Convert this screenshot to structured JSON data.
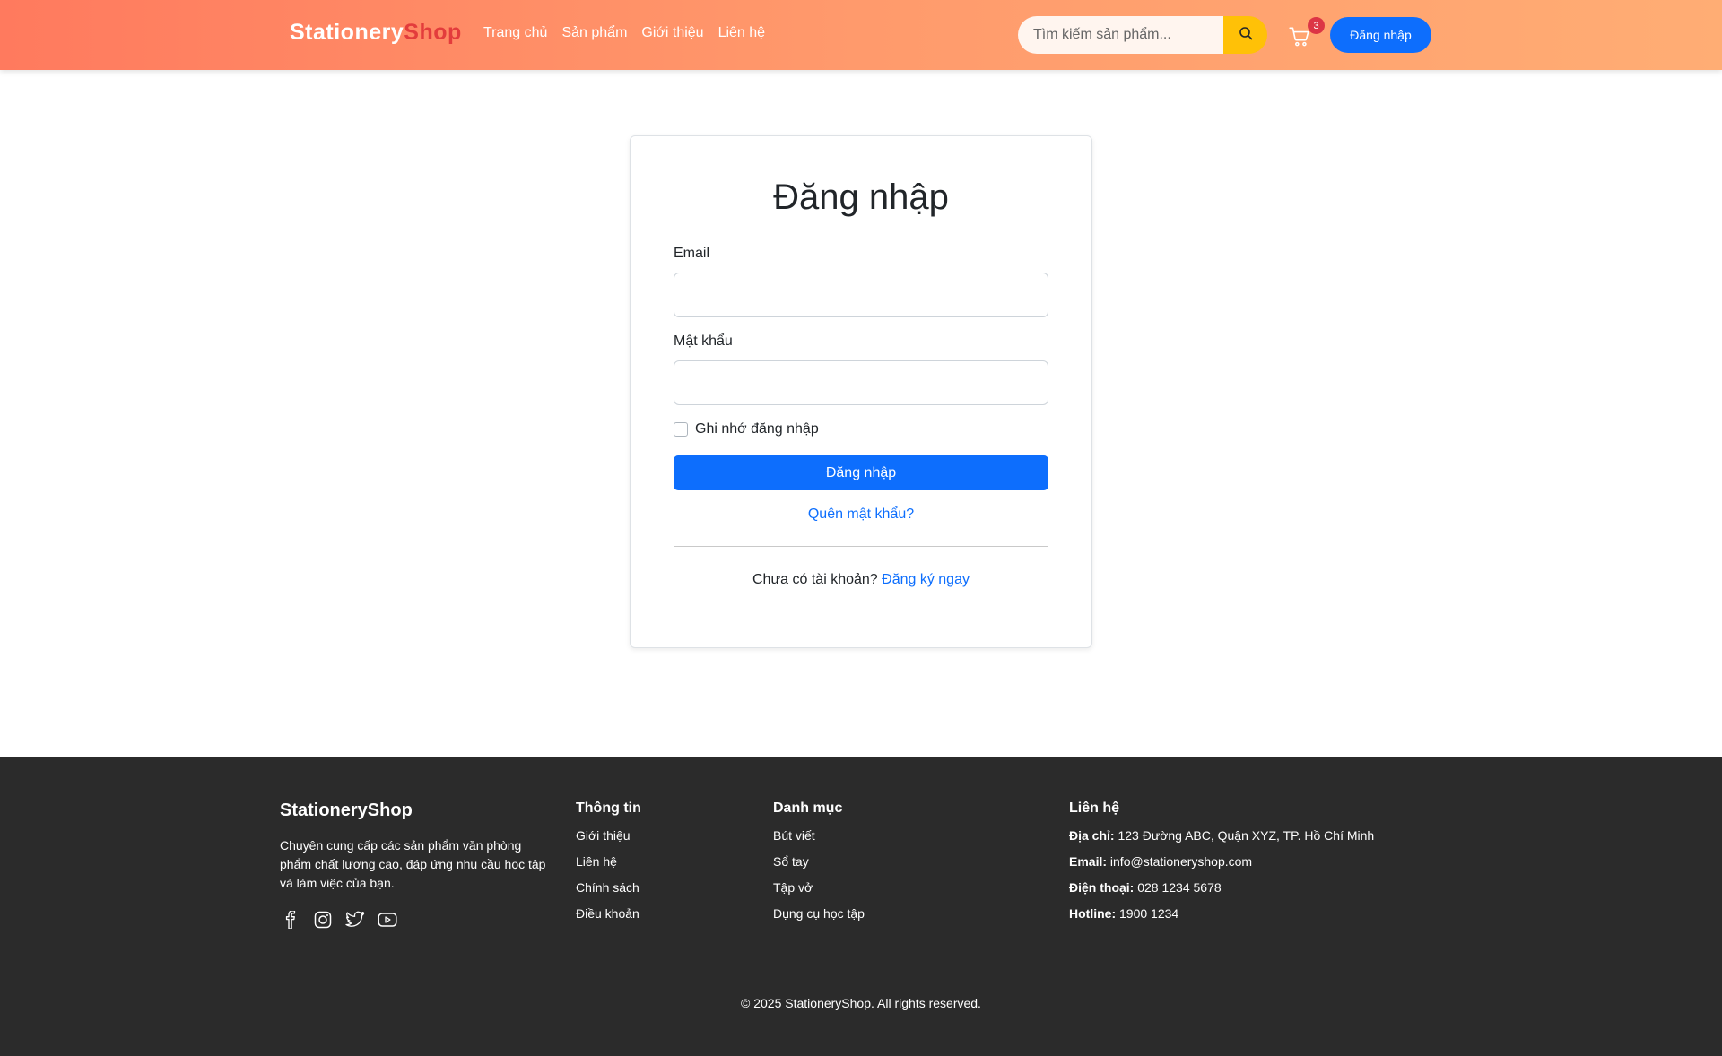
{
  "header": {
    "brand_part1": "Stationery",
    "brand_part2": "Shop",
    "nav": [
      "Trang chủ",
      "Sản phẩm",
      "Giới thiệu",
      "Liên hệ"
    ],
    "search_placeholder": "Tìm kiếm sản phẩm...",
    "search_icon": "search-icon",
    "cart_icon": "cart-icon",
    "cart_count": "3",
    "login_label": "Đăng nhập"
  },
  "login_form": {
    "title": "Đăng nhập",
    "email_label": "Email",
    "email_value": "",
    "password_label": "Mật khẩu",
    "password_value": "",
    "remember_label": "Ghi nhớ đăng nhập",
    "remember_checked": false,
    "submit_label": "Đăng nhập",
    "forgot_label": "Quên mật khẩu?",
    "no_account_text": "Chưa có tài khoản?",
    "signup_link": "Đăng ký ngay"
  },
  "footer": {
    "brand": "StationeryShop",
    "description": "Chuyên cung cấp các sản phẩm văn phòng phẩm chất lượng cao, đáp ứng nhu cầu học tập và làm việc của bạn.",
    "socials": [
      "facebook-icon",
      "instagram-icon",
      "twitter-icon",
      "youtube-icon"
    ],
    "info": {
      "heading": "Thông tin",
      "links": [
        "Giới thiệu",
        "Liên hệ",
        "Chính sách",
        "Điều khoản"
      ]
    },
    "categories": {
      "heading": "Danh mục",
      "links": [
        "Bút viết",
        "Sổ tay",
        "Tập vở",
        "Dụng cụ học tập"
      ]
    },
    "contact": {
      "heading": "Liên hệ",
      "address_label": "Địa chỉ:",
      "address": "123 Đường ABC, Quận XYZ, TP. Hồ Chí Minh",
      "email_label": "Email:",
      "email": "info@stationeryshop.com",
      "phone_label": "Điện thoại:",
      "phone": "028 1234 5678",
      "hotline_label": "Hotline:",
      "hotline": "1900 1234"
    },
    "copyright": "© 2025 StationeryShop. All rights reserved."
  },
  "colors": {
    "header_gradient_start": "#ff7a5e",
    "header_gradient_end": "#ffad74",
    "primary": "#0d6efd",
    "search_button": "#ffc107",
    "badge": "#dc3545",
    "brand_accent": "#e33c3c",
    "footer_bg": "#2b2b2b"
  }
}
